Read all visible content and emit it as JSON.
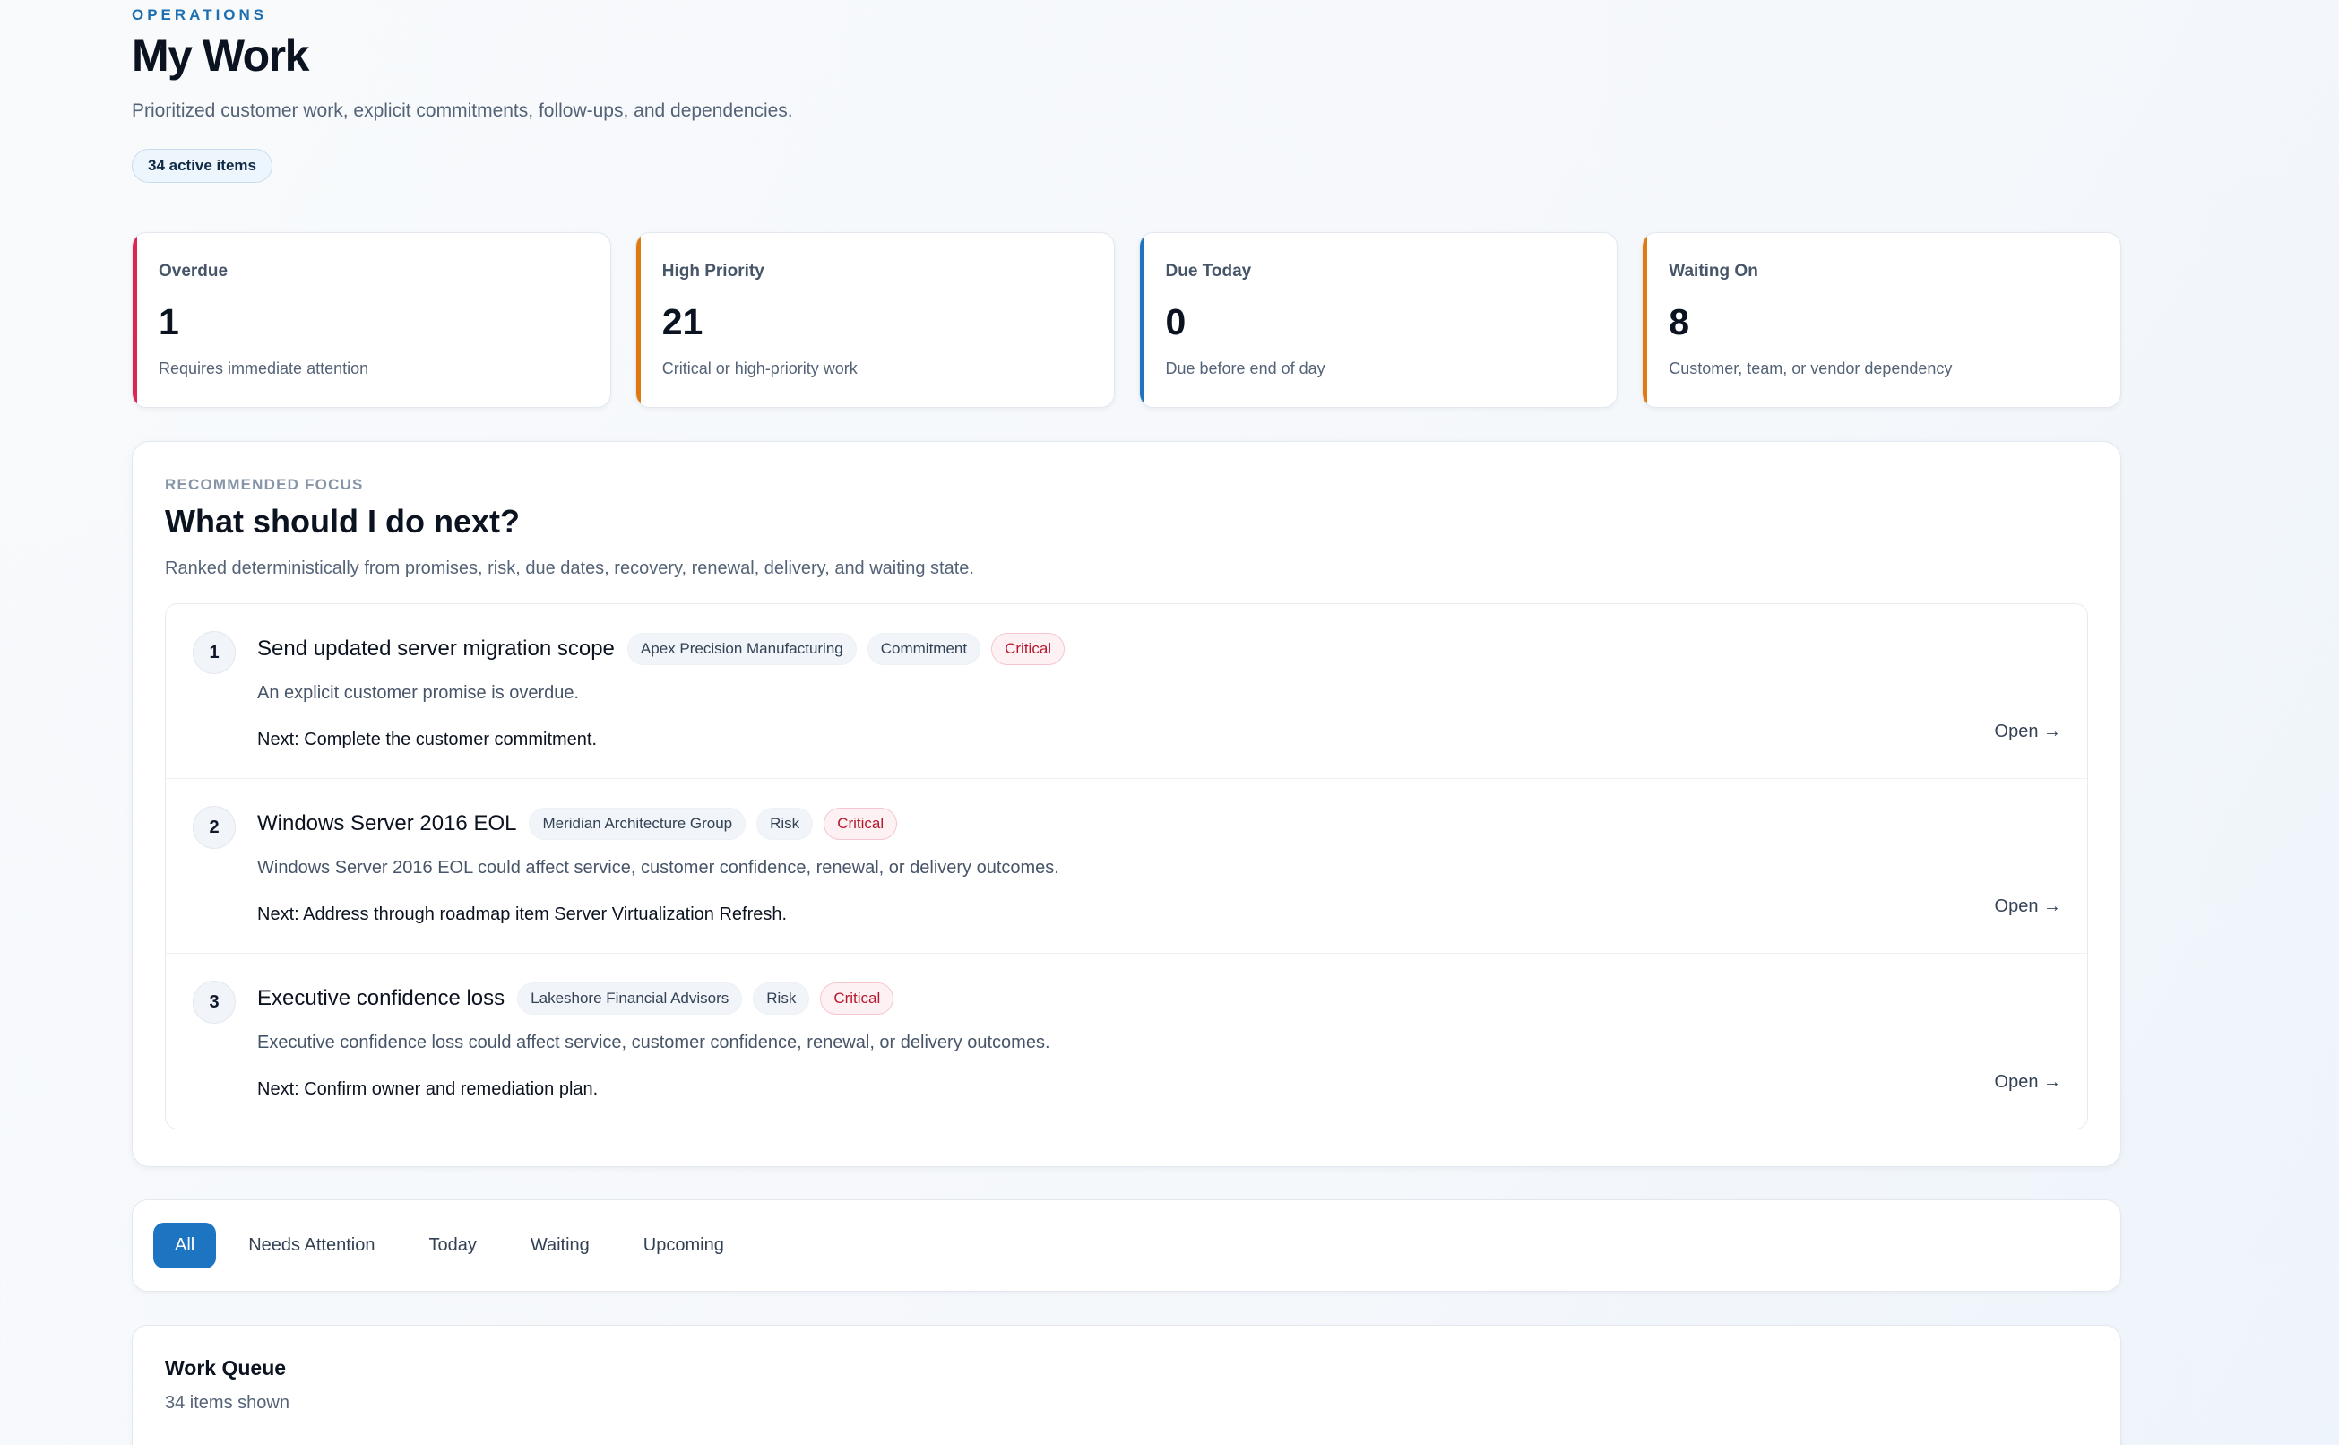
{
  "header": {
    "eyebrow": "OPERATIONS",
    "title": "My Work",
    "subtitle": "Prioritized customer work, explicit commitments, follow-ups, and dependencies.",
    "active_items": "34 active items"
  },
  "stats": [
    {
      "label": "Overdue",
      "value": "1",
      "desc": "Requires immediate attention",
      "accent": "#dc2650"
    },
    {
      "label": "High Priority",
      "value": "21",
      "desc": "Critical or high-priority work",
      "accent": "#e07a10"
    },
    {
      "label": "Due Today",
      "value": "0",
      "desc": "Due before end of day",
      "accent": "#1d74c0"
    },
    {
      "label": "Waiting On",
      "value": "8",
      "desc": "Customer, team, or vendor dependency",
      "accent": "#e07a10"
    }
  ],
  "focus": {
    "eyebrow": "RECOMMENDED FOCUS",
    "title": "What should I do next?",
    "subtitle": "Ranked deterministically from promises, risk, due dates, recovery, renewal, delivery, and waiting state.",
    "items": [
      {
        "rank": "1",
        "title": "Send updated server migration scope",
        "customer": "Apex Precision Manufacturing",
        "type": "Commitment",
        "severity": "Critical",
        "reason": "An explicit customer promise is overdue.",
        "next": "Next: Complete the customer commitment.",
        "open": "Open →"
      },
      {
        "rank": "2",
        "title": "Windows Server 2016 EOL",
        "customer": "Meridian Architecture Group",
        "type": "Risk",
        "severity": "Critical",
        "reason": "Windows Server 2016 EOL could affect service, customer confidence, renewal, or delivery outcomes.",
        "next": "Next: Address through roadmap item Server Virtualization Refresh.",
        "open": "Open →"
      },
      {
        "rank": "3",
        "title": "Executive confidence loss",
        "customer": "Lakeshore Financial Advisors",
        "type": "Risk",
        "severity": "Critical",
        "reason": "Executive confidence loss could affect service, customer confidence, renewal, or delivery outcomes.",
        "next": "Next: Confirm owner and remediation plan.",
        "open": "Open →"
      }
    ]
  },
  "tabs": [
    {
      "label": "All",
      "active": true
    },
    {
      "label": "Needs Attention",
      "active": false
    },
    {
      "label": "Today",
      "active": false
    },
    {
      "label": "Waiting",
      "active": false
    },
    {
      "label": "Upcoming",
      "active": false
    }
  ],
  "queue": {
    "title": "Work Queue",
    "count": "34 items shown"
  },
  "colors": {
    "primary": "#1d74c0",
    "critical": "#b4182d",
    "overdue": "#dc2650",
    "warning": "#e07a10"
  }
}
